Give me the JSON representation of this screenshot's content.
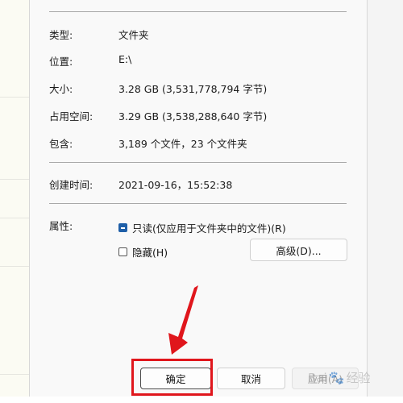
{
  "properties": {
    "type_label": "类型:",
    "type_value": "文件夹",
    "location_label": "位置:",
    "location_value": "E:\\",
    "size_label": "大小:",
    "size_value": "3.28 GB (3,531,778,794 字节)",
    "size_on_disk_label": "占用空间:",
    "size_on_disk_value": "3.29 GB (3,538,288,640 字节)",
    "contains_label": "包含:",
    "contains_value": "3,189 个文件，23 个文件夹",
    "created_label": "创建时间:",
    "created_value": "2021-09-16，15:52:38",
    "attributes_label": "属性:"
  },
  "attributes": {
    "readonly_label": "只读(仅应用于文件夹中的文件)(R)",
    "hidden_label": "隐藏(H)",
    "advanced_button": "高级(D)..."
  },
  "buttons": {
    "ok": "确定",
    "cancel": "取消",
    "apply": "应用(A)"
  },
  "watermark": {
    "text_left": "Bai",
    "text_right": "经验"
  },
  "colors": {
    "highlight": "#e0161c",
    "annotation_arrow": "#e0161c",
    "checkbox_accent": "#1f5fa8"
  }
}
